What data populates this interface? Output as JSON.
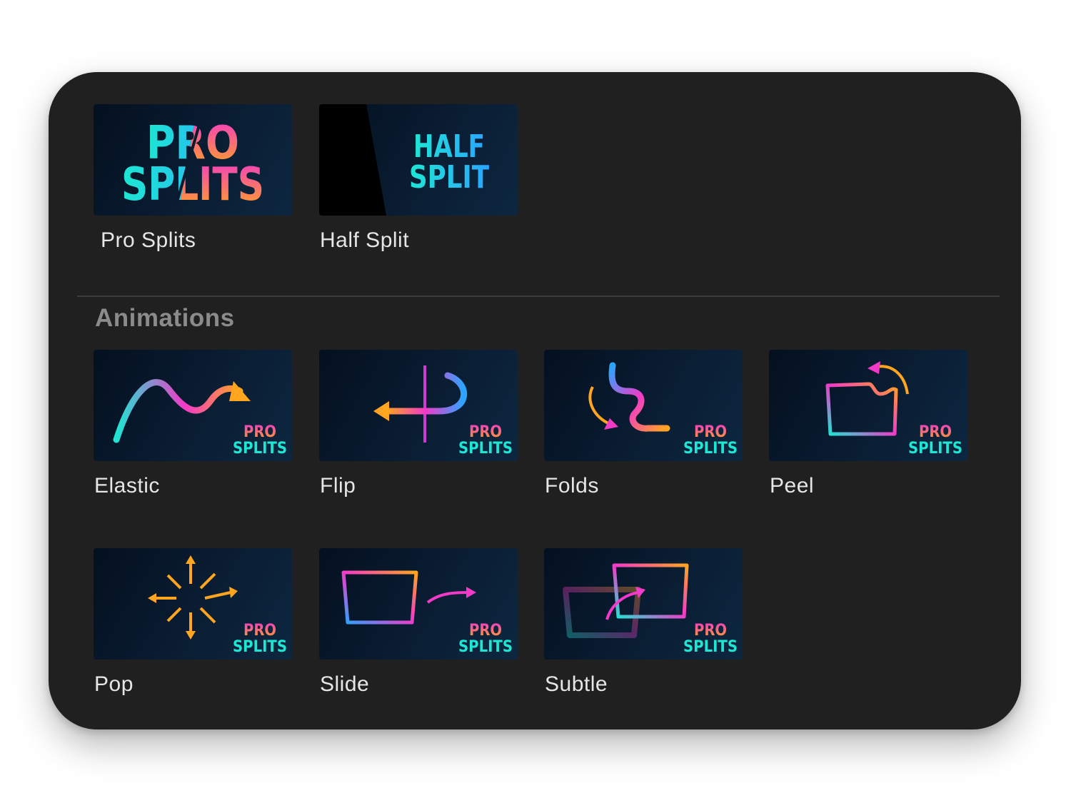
{
  "top_items": [
    {
      "label": "Pro Splits",
      "thumb_text": [
        "PRO",
        "SPLITS"
      ]
    },
    {
      "label": "Half Split",
      "thumb_text": [
        "HALF",
        "SPLIT"
      ]
    }
  ],
  "animations": {
    "section_title": "Animations",
    "items": [
      {
        "label": "Elastic",
        "icon": "elastic-curve-arrow-icon"
      },
      {
        "label": "Flip",
        "icon": "flip-arrow-icon"
      },
      {
        "label": "Folds",
        "icon": "folds-squiggle-icon"
      },
      {
        "label": "Peel",
        "icon": "peel-folder-icon"
      },
      {
        "label": "Pop",
        "icon": "pop-burst-icon"
      },
      {
        "label": "Slide",
        "icon": "slide-frame-arrow-icon"
      },
      {
        "label": "Subtle",
        "icon": "subtle-frames-icon"
      }
    ],
    "badge_text": [
      "PRO",
      "SPLITS"
    ]
  },
  "colors": {
    "panel_bg": "#202020",
    "cyan": "#1ee6d4",
    "magenta": "#f23ac8",
    "orange": "#ffa51f",
    "blue": "#2aa5ff"
  }
}
